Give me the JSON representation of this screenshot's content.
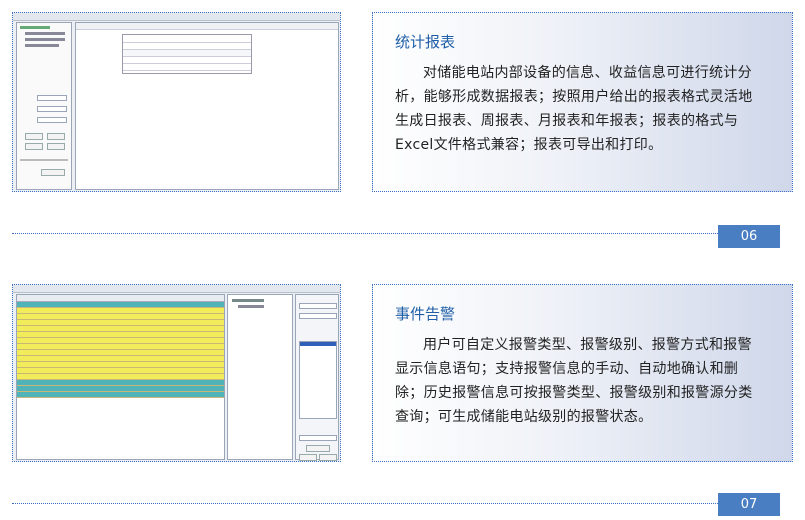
{
  "sections": [
    {
      "title": "统计报表",
      "body": "对储能电站内部设备的信息、收益信息可进行统计分析，能够形成数据报表；按照用户给出的报表格式灵活地生成日报表、周报表、月报表和年报表；报表的格式与Excel文件格式兼容；报表可导出和打印。",
      "page_number": "06"
    },
    {
      "title": "事件告警",
      "body": "用户可自定义报警类型、报警级别、报警方式和报警显示信息语句；支持报警信息的手动、自动地确认和删除；历史报警信息可按报警类型、报警级别和报警源分类查询；可生成储能电站级别的报警状态。",
      "page_number": "07"
    }
  ],
  "colors": {
    "accent": "#1f5fa8",
    "page_badge": "#4a7ec2",
    "border": "#3a6fc4",
    "alarm_yellow": "#f2ec5a",
    "alarm_teal": "#4fb3b8"
  }
}
